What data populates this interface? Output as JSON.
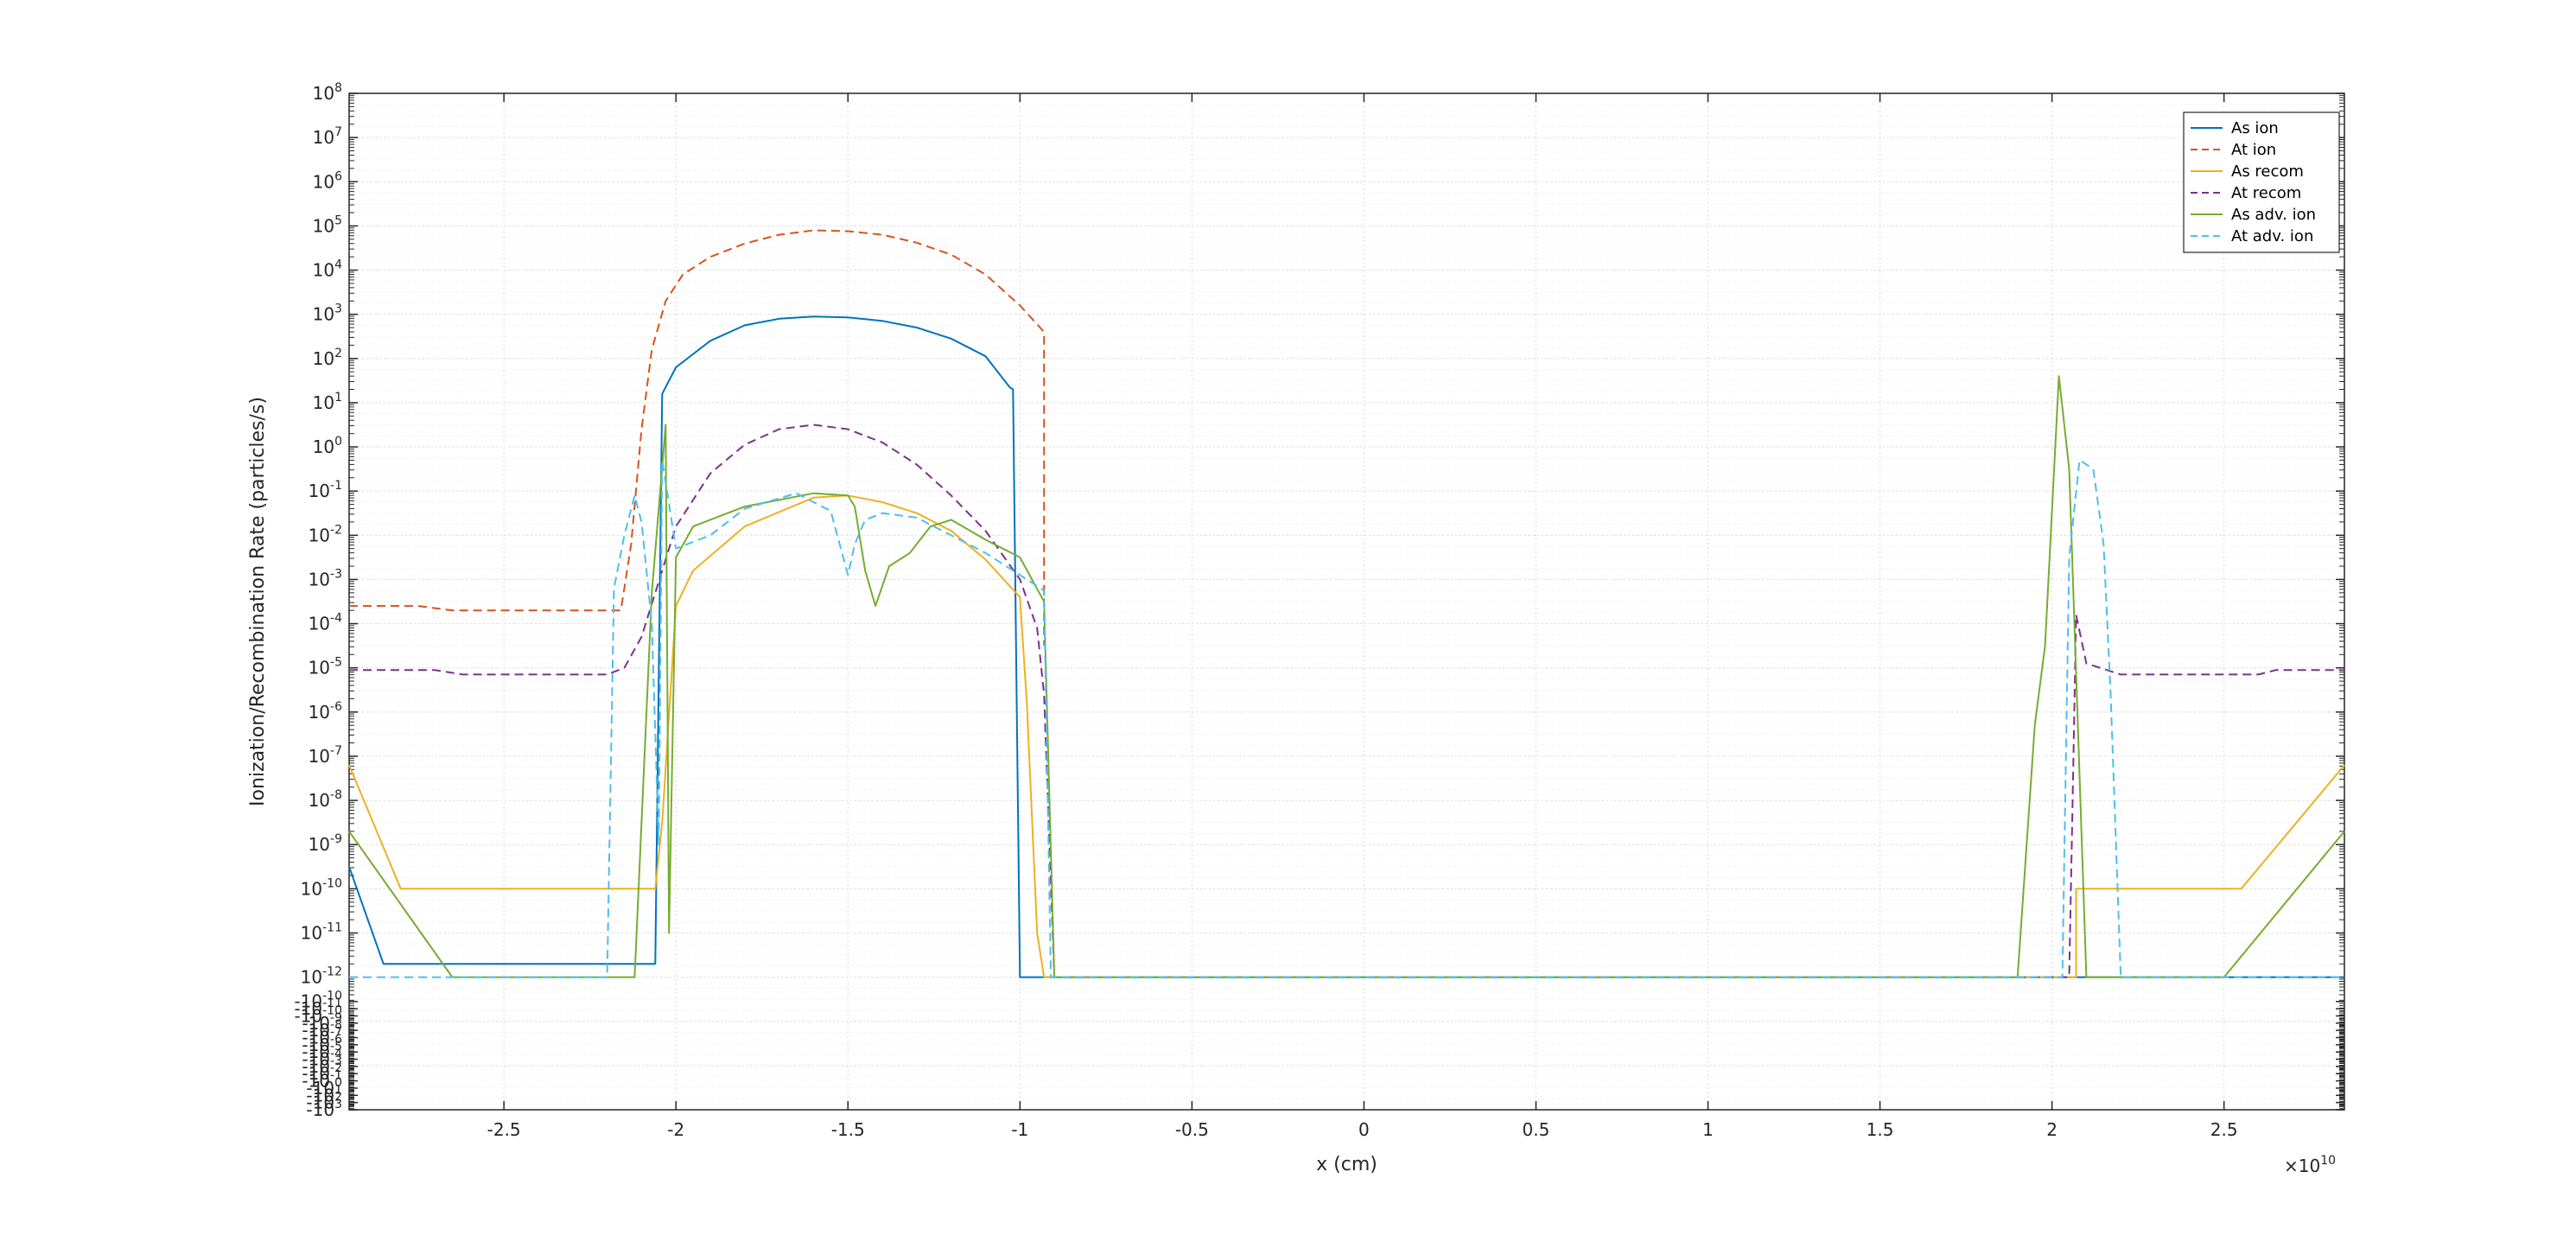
{
  "chart_data": {
    "type": "line",
    "xlabel": "x (cm)",
    "ylabel": "Ionization/Recombination Rate (particles/s)",
    "x_exponent_label": "10",
    "x_multiplier_prefix": "×",
    "xlim": [
      -2.95,
      2.85
    ],
    "x_ticks": [
      -2.5,
      -2,
      -1.5,
      -1,
      -0.5,
      0,
      0.5,
      1,
      1.5,
      2,
      2.5
    ],
    "x_tick_labels": [
      "-2.5",
      "-2",
      "-1.5",
      "-1",
      "-0.5",
      "0",
      "0.5",
      "1",
      "1.5",
      "2",
      "2.5"
    ],
    "y_scale": "symlog",
    "y_ticks_positive": [
      {
        "base": "10",
        "exp": "8"
      },
      {
        "base": "10",
        "exp": "7"
      },
      {
        "base": "10",
        "exp": "6"
      },
      {
        "base": "10",
        "exp": "5"
      },
      {
        "base": "10",
        "exp": "4"
      },
      {
        "base": "10",
        "exp": "3"
      },
      {
        "base": "10",
        "exp": "2"
      },
      {
        "base": "10",
        "exp": "1"
      },
      {
        "base": "10",
        "exp": "0"
      },
      {
        "base": "10",
        "exp": "-1"
      },
      {
        "base": "10",
        "exp": "-2"
      },
      {
        "base": "10",
        "exp": "-3"
      },
      {
        "base": "10",
        "exp": "-4"
      },
      {
        "base": "10",
        "exp": "-5"
      },
      {
        "base": "10",
        "exp": "-6"
      },
      {
        "base": "10",
        "exp": "-7"
      },
      {
        "base": "10",
        "exp": "-8"
      },
      {
        "base": "10",
        "exp": "-9"
      },
      {
        "base": "10",
        "exp": "-10"
      },
      {
        "base": "10",
        "exp": "-11"
      },
      {
        "base": "10",
        "exp": "-12"
      }
    ],
    "y_ticks_negative": [
      {
        "base": "-10",
        "exp": "-10"
      },
      {
        "base": "-10",
        "exp": "-11"
      },
      {
        "base": "-10",
        "exp": "-10"
      },
      {
        "base": "-10",
        "exp": "-9"
      },
      {
        "base": "-10",
        "exp": "-8"
      },
      {
        "base": "-10",
        "exp": "-7"
      },
      {
        "base": "-10",
        "exp": "-6"
      },
      {
        "base": "-10",
        "exp": "-5"
      },
      {
        "base": "-10",
        "exp": "-4"
      },
      {
        "base": "-10",
        "exp": "-3"
      },
      {
        "base": "-10",
        "exp": "-2"
      },
      {
        "base": "-10",
        "exp": "-1"
      },
      {
        "base": "-10",
        "exp": "0"
      },
      {
        "base": "-10",
        "exp": "1"
      },
      {
        "base": "-10",
        "exp": "2"
      },
      {
        "base": "-10",
        "exp": "3"
      }
    ],
    "grid": true,
    "legend_position": "top-right",
    "series": [
      {
        "name": "As ion",
        "color": "#0072BD",
        "dash": "solid",
        "points": [
          [
            -2.95,
            -9.5
          ],
          [
            -2.85,
            -11.7
          ],
          [
            -2.2,
            -11.7
          ],
          [
            -2.06,
            -11.7
          ],
          [
            -2.04,
            1.2
          ],
          [
            -2.0,
            1.8
          ],
          [
            -1.9,
            2.4
          ],
          [
            -1.8,
            2.75
          ],
          [
            -1.7,
            2.9
          ],
          [
            -1.6,
            2.95
          ],
          [
            -1.5,
            2.93
          ],
          [
            -1.4,
            2.85
          ],
          [
            -1.3,
            2.7
          ],
          [
            -1.2,
            2.45
          ],
          [
            -1.1,
            2.05
          ],
          [
            -1.03,
            1.35
          ],
          [
            -1.02,
            1.3
          ],
          [
            -1.0,
            -12
          ],
          [
            -0.9,
            -12
          ],
          [
            2.85,
            -12
          ]
        ]
      },
      {
        "name": "At ion",
        "color": "#D95319",
        "dash": "dashed",
        "points": [
          [
            -2.95,
            -3.6
          ],
          [
            -2.75,
            -3.6
          ],
          [
            -2.65,
            -3.7
          ],
          [
            -2.2,
            -3.7
          ],
          [
            -2.16,
            -3.7
          ],
          [
            -2.13,
            -2.2
          ],
          [
            -2.1,
            0.4
          ],
          [
            -2.07,
            2.2
          ],
          [
            -2.03,
            3.3
          ],
          [
            -1.98,
            3.9
          ],
          [
            -1.9,
            4.3
          ],
          [
            -1.8,
            4.6
          ],
          [
            -1.7,
            4.8
          ],
          [
            -1.6,
            4.9
          ],
          [
            -1.5,
            4.88
          ],
          [
            -1.4,
            4.8
          ],
          [
            -1.3,
            4.62
          ],
          [
            -1.2,
            4.35
          ],
          [
            -1.1,
            3.9
          ],
          [
            -1.0,
            3.2
          ],
          [
            -0.93,
            2.6
          ],
          [
            -0.93,
            -4.5
          ]
        ]
      },
      {
        "name": "As recom",
        "color": "#EDB120",
        "dash": "solid",
        "points": [
          [
            -2.95,
            -7.2
          ],
          [
            -2.8,
            -10
          ],
          [
            -2.06,
            -10
          ],
          [
            -2.04,
            -8.5
          ],
          [
            -2.0,
            -3.6
          ],
          [
            -1.95,
            -2.8
          ],
          [
            -1.8,
            -1.8
          ],
          [
            -1.6,
            -1.15
          ],
          [
            -1.5,
            -1.1
          ],
          [
            -1.4,
            -1.25
          ],
          [
            -1.3,
            -1.5
          ],
          [
            -1.2,
            -1.9
          ],
          [
            -1.1,
            -2.55
          ],
          [
            -1.0,
            -3.4
          ],
          [
            -0.98,
            -5.8
          ],
          [
            -0.95,
            -11
          ],
          [
            -0.93,
            -12
          ],
          [
            1.95,
            -12
          ],
          [
            2.07,
            -12
          ],
          [
            2.07,
            -10
          ],
          [
            2.55,
            -10
          ],
          [
            2.85,
            -7.2
          ]
        ]
      },
      {
        "name": "At recom",
        "color": "#7E2F8E",
        "dash": "dashed",
        "points": [
          [
            -2.95,
            -5.05
          ],
          [
            -2.7,
            -5.05
          ],
          [
            -2.62,
            -5.15
          ],
          [
            -2.2,
            -5.15
          ],
          [
            -2.15,
            -5.0
          ],
          [
            -2.1,
            -4.3
          ],
          [
            -2.06,
            -3.3
          ],
          [
            -2.0,
            -1.8
          ],
          [
            -1.9,
            -0.6
          ],
          [
            -1.8,
            0.05
          ],
          [
            -1.7,
            0.4
          ],
          [
            -1.6,
            0.5
          ],
          [
            -1.5,
            0.4
          ],
          [
            -1.4,
            0.1
          ],
          [
            -1.3,
            -0.4
          ],
          [
            -1.2,
            -1.1
          ],
          [
            -1.1,
            -1.9
          ],
          [
            -1.0,
            -3.0
          ],
          [
            -0.95,
            -4.1
          ],
          [
            -0.93,
            -5.6
          ],
          [
            -0.9,
            -12
          ],
          [
            2.05,
            -12
          ],
          [
            2.06,
            -8
          ],
          [
            2.07,
            -3.8
          ],
          [
            2.1,
            -4.9
          ],
          [
            2.2,
            -5.15
          ],
          [
            2.6,
            -5.15
          ],
          [
            2.65,
            -5.05
          ],
          [
            2.85,
            -5.05
          ]
        ]
      },
      {
        "name": "As adv. ion",
        "color": "#77AC30",
        "dash": "solid",
        "points": [
          [
            -2.95,
            -8.7
          ],
          [
            -2.65,
            -12
          ],
          [
            -2.12,
            -12
          ],
          [
            -2.07,
            -3.3
          ],
          [
            -2.03,
            0.5
          ],
          [
            -2.02,
            -11
          ],
          [
            -2.0,
            -2.5
          ],
          [
            -1.95,
            -1.8
          ],
          [
            -1.8,
            -1.35
          ],
          [
            -1.6,
            -1.05
          ],
          [
            -1.5,
            -1.1
          ],
          [
            -1.48,
            -1.35
          ],
          [
            -1.45,
            -2.8
          ],
          [
            -1.42,
            -3.6
          ],
          [
            -1.38,
            -2.7
          ],
          [
            -1.32,
            -2.4
          ],
          [
            -1.28,
            -2.0
          ],
          [
            -1.26,
            -1.8
          ],
          [
            -1.2,
            -1.65
          ],
          [
            -1.1,
            -2.1
          ],
          [
            -1.0,
            -2.5
          ],
          [
            -0.93,
            -3.5
          ],
          [
            -0.9,
            -12
          ],
          [
            1.9,
            -12
          ],
          [
            1.95,
            -6.3
          ],
          [
            1.98,
            -4.5
          ],
          [
            2.02,
            1.6
          ],
          [
            2.05,
            -0.5
          ],
          [
            2.1,
            -12
          ],
          [
            2.5,
            -12
          ],
          [
            2.85,
            -8.7
          ]
        ]
      },
      {
        "name": "At adv. ion",
        "color": "#4DBEEE",
        "dash": "dashed",
        "points": [
          [
            -2.95,
            -12
          ],
          [
            -2.2,
            -12
          ],
          [
            -2.18,
            -3.2
          ],
          [
            -2.15,
            -2.0
          ],
          [
            -2.12,
            -1.1
          ],
          [
            -2.1,
            -1.7
          ],
          [
            -2.07,
            -4.0
          ],
          [
            -2.05,
            -9
          ],
          [
            -2.04,
            -0.3
          ],
          [
            -2.0,
            -2.3
          ],
          [
            -1.9,
            -2.0
          ],
          [
            -1.8,
            -1.4
          ],
          [
            -1.65,
            -1.05
          ],
          [
            -1.55,
            -1.45
          ],
          [
            -1.5,
            -2.9
          ],
          [
            -1.48,
            -2.2
          ],
          [
            -1.45,
            -1.65
          ],
          [
            -1.4,
            -1.5
          ],
          [
            -1.3,
            -1.6
          ],
          [
            -1.1,
            -2.4
          ],
          [
            -0.93,
            -3.25
          ],
          [
            -0.91,
            -12
          ],
          [
            2.03,
            -12
          ],
          [
            2.05,
            -2.5
          ],
          [
            2.08,
            -0.3
          ],
          [
            2.12,
            -0.5
          ],
          [
            2.15,
            -2.2
          ],
          [
            2.17,
            -5.5
          ],
          [
            2.2,
            -12
          ],
          [
            2.85,
            -12
          ]
        ]
      }
    ]
  }
}
